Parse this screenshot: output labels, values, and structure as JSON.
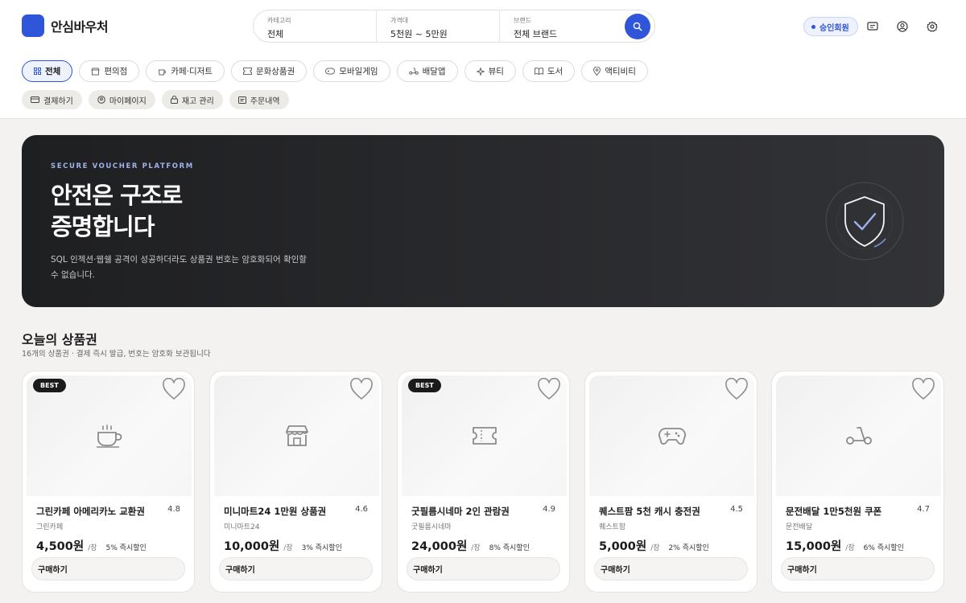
{
  "app": {
    "logo_text": "안심바우처"
  },
  "search": {
    "fields": [
      {
        "label": "카테고리",
        "value": "전체"
      },
      {
        "label": "가격대",
        "value": "5천원 ~ 5만원"
      },
      {
        "label": "브랜드",
        "value": "전체 브랜드"
      }
    ],
    "button_icon": "search-icon"
  },
  "header": {
    "member_badge": "승인회원",
    "icons": [
      "chat-icon",
      "user-icon",
      "gear-icon"
    ]
  },
  "categories": [
    {
      "label": "전체",
      "icon": "grid-icon",
      "active": true
    },
    {
      "label": "편의점",
      "icon": "store-icon"
    },
    {
      "label": "카페·디저트",
      "icon": "cup-icon"
    },
    {
      "label": "문화상품권",
      "icon": "ticket-icon"
    },
    {
      "label": "모바일게임",
      "icon": "gamepad-icon"
    },
    {
      "label": "배달앱",
      "icon": "scooter-icon"
    },
    {
      "label": "뷰티",
      "icon": "sparkle-icon"
    },
    {
      "label": "도서",
      "icon": "book-icon"
    },
    {
      "label": "액티비티",
      "icon": "pin-icon"
    }
  ],
  "utilities": [
    {
      "label": "결제하기",
      "icon": "card-icon"
    },
    {
      "label": "마이페이지",
      "icon": "user-circle-icon"
    },
    {
      "label": "재고 관리",
      "icon": "lock-icon"
    },
    {
      "label": "주문내역",
      "icon": "receipt-icon"
    }
  ],
  "hero": {
    "eyebrow": "SECURE VOUCHER PLATFORM",
    "title_line1": "안전은 구조로",
    "title_line2": "증명합니다",
    "description": "SQL 인젝션·웹쉘 공격이 성공하더라도 상품권 번호는 암호화되어 확인할 수 없습니다.",
    "icon": "shield-check-icon"
  },
  "section": {
    "title": "오늘의 상품권",
    "subtitle": "16개의 상품권 · 결제 즉시 발급, 번호는 암호화 보관됩니다"
  },
  "products": [
    {
      "name": "그린카페 아메리카노 교환권",
      "brand": "그린카페",
      "rating": "4.8",
      "price": "4,500원",
      "unit": "/장",
      "discount": "5% 즉시할인",
      "badge": "BEST",
      "icon": "coffee-icon",
      "button": "구매하기"
    },
    {
      "name": "미니마트24 1만원 상품권",
      "brand": "미니마트24",
      "rating": "4.6",
      "price": "10,000원",
      "unit": "/장",
      "discount": "3% 즉시할인",
      "badge": "",
      "icon": "store-icon",
      "button": "구매하기"
    },
    {
      "name": "굿필름시네마 2인 관람권",
      "brand": "굿필름시네마",
      "rating": "4.9",
      "price": "24,000원",
      "unit": "/장",
      "discount": "8% 즉시할인",
      "badge": "BEST",
      "icon": "ticket-icon",
      "button": "구매하기"
    },
    {
      "name": "퀘스트팜 5천 캐시 충전권",
      "brand": "퀘스트팜",
      "rating": "4.5",
      "price": "5,000원",
      "unit": "/장",
      "discount": "2% 즉시할인",
      "badge": "",
      "icon": "gamepad-icon",
      "button": "구매하기"
    },
    {
      "name": "문전배달 1만5천원 쿠폰",
      "brand": "문전배달",
      "rating": "4.7",
      "price": "15,000원",
      "unit": "/장",
      "discount": "6% 즉시할인",
      "badge": "",
      "icon": "scooter-icon",
      "button": "구매하기"
    }
  ],
  "colors": {
    "accent": "#2f55d8",
    "hero_bg": "#1e1f21",
    "page_bg": "#f3f2f0"
  }
}
